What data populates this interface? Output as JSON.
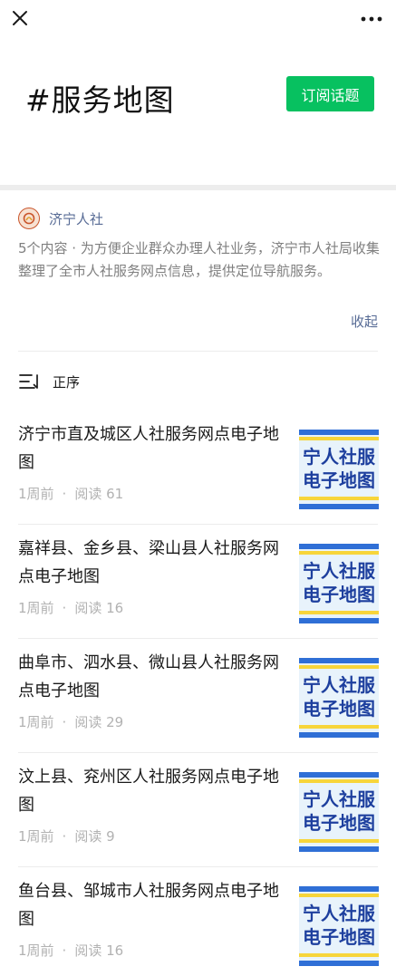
{
  "topbar": {
    "close_icon": "close-icon",
    "more_icon": "more-dots-icon"
  },
  "hero": {
    "title": "#服务地图",
    "subscribe_label": "订阅话题",
    "subscribe_color": "#07c160"
  },
  "author": {
    "name": "济宁人社",
    "logo_icon": "institution-logo-icon"
  },
  "description": "5个内容 · 为方便企业群众办理人社业务，济宁市人社局收集整理了全市人社服务网点信息，提供定位导航服务。",
  "collapse_label": "收起",
  "sort": {
    "label": "正序",
    "icon": "sort-ascending-icon"
  },
  "thumb_text": {
    "line1": "宁人社服",
    "line2": "电子地图"
  },
  "articles": [
    {
      "title": "济宁市直及城区人社服务网点电子地图",
      "time": "1周前",
      "reads": "阅读 61"
    },
    {
      "title": "嘉祥县、金乡县、梁山县人社服务网点电子地图",
      "time": "1周前",
      "reads": "阅读 16"
    },
    {
      "title": "曲阜市、泗水县、微山县人社服务网点电子地图",
      "time": "1周前",
      "reads": "阅读 29"
    },
    {
      "title": "汶上县、兖州区人社服务网点电子地图",
      "time": "1周前",
      "reads": "阅读 9"
    },
    {
      "title": "鱼台县、邹城市人社服务网点电子地图",
      "time": "1周前",
      "reads": "阅读 16"
    }
  ],
  "colors": {
    "link": "#576b95",
    "muted": "#b2b2b2",
    "band": "#ededed"
  }
}
